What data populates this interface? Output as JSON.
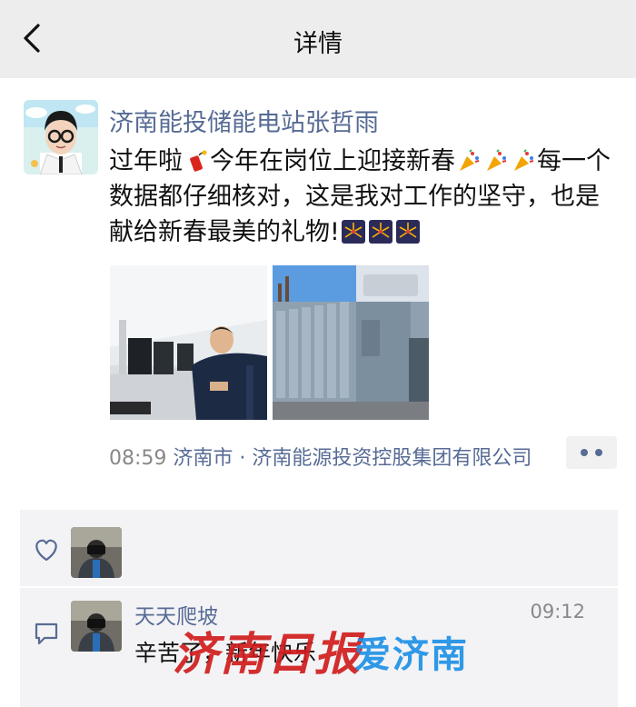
{
  "header": {
    "title": "详情",
    "back_icon": "chevron-left-icon"
  },
  "post": {
    "author": "济南能投储能电站张哲雨",
    "text_part1": "过年啦",
    "text_part2": "今年在岗位上迎接新春",
    "text_part3": "每一个数据都仔细核对，这是我对工作的坚守，也是献给新春最美的礼物!",
    "emoji_1": "firecracker",
    "emoji_2": "party-popper",
    "emoji_3": "fireworks",
    "photos": [
      "control-room-photo",
      "transformer-station-photo"
    ],
    "time": "08:59",
    "location_city": "济南市",
    "separator": " · ",
    "location_org": "济南能源投资控股集团有限公司",
    "more_icon": "more-dots-icon"
  },
  "likes": {
    "icon": "heart-icon"
  },
  "comments": [
    {
      "name": "天天爬坡",
      "time": "09:12",
      "text": "辛苦了，新年快乐"
    }
  ],
  "watermark": {
    "left": "济南日报",
    "right": "爱济南"
  },
  "colors": {
    "link_blue": "#576b95",
    "header_bg": "#ededed",
    "panel_bg": "#f3f3f5",
    "watermark_red": "#d11e1e",
    "watermark_blue": "#1a8fe6"
  }
}
